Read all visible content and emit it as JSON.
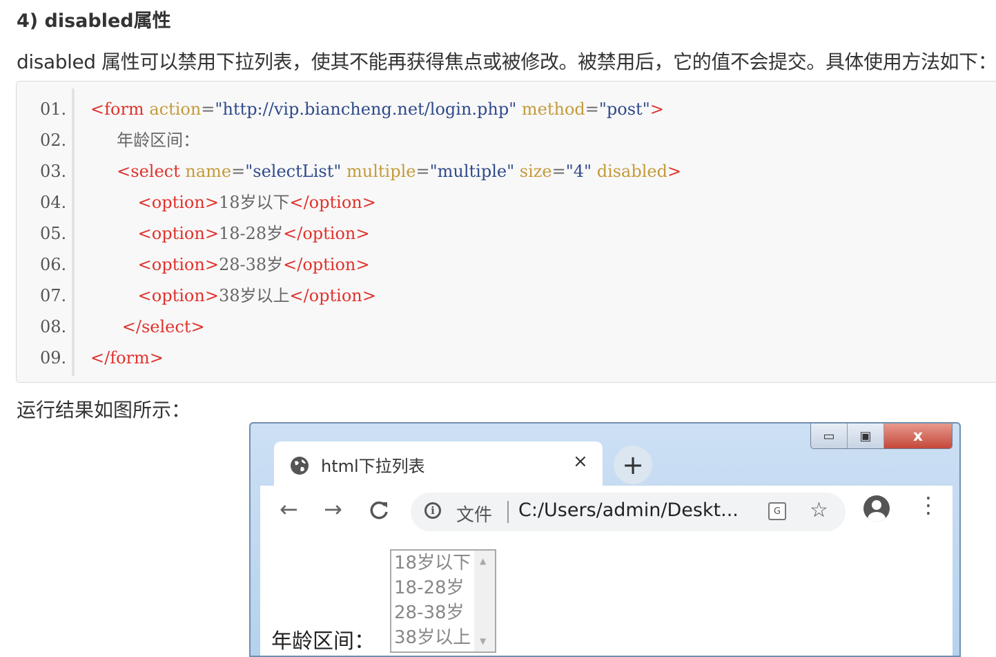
{
  "heading": "4) disabled属性",
  "paragraph": "disabled 属性可以禁用下拉列表，使其不能再获得焦点或被修改。被禁用后，它的值不会提交。具体使用方法如下：",
  "code": {
    "line_numbers": [
      "01.",
      "02.",
      "03.",
      "04.",
      "05.",
      "06.",
      "07.",
      "08.",
      "09."
    ],
    "lines": [
      [
        {
          "t": "tag",
          "v": "<form"
        },
        {
          "t": "txt",
          "v": " "
        },
        {
          "t": "attr",
          "v": "action"
        },
        {
          "t": "txt",
          "v": "="
        },
        {
          "t": "str",
          "v": "\"http://vip.biancheng.net/login.php\""
        },
        {
          "t": "txt",
          "v": " "
        },
        {
          "t": "attr",
          "v": "method"
        },
        {
          "t": "txt",
          "v": "="
        },
        {
          "t": "str",
          "v": "\"post\""
        },
        {
          "t": "tag",
          "v": ">"
        }
      ],
      [
        {
          "t": "txt",
          "v": "     年龄区间："
        }
      ],
      [
        {
          "t": "txt",
          "v": "     "
        },
        {
          "t": "tag",
          "v": "<select"
        },
        {
          "t": "txt",
          "v": " "
        },
        {
          "t": "attr",
          "v": "name"
        },
        {
          "t": "txt",
          "v": "="
        },
        {
          "t": "str",
          "v": "\"selectList\""
        },
        {
          "t": "txt",
          "v": " "
        },
        {
          "t": "attr",
          "v": "multiple"
        },
        {
          "t": "txt",
          "v": "="
        },
        {
          "t": "str",
          "v": "\"multiple\""
        },
        {
          "t": "txt",
          "v": " "
        },
        {
          "t": "attr",
          "v": "size"
        },
        {
          "t": "txt",
          "v": "="
        },
        {
          "t": "str",
          "v": "\"4\""
        },
        {
          "t": "txt",
          "v": " "
        },
        {
          "t": "attr",
          "v": "disabled"
        },
        {
          "t": "tag",
          "v": ">"
        }
      ],
      [
        {
          "t": "txt",
          "v": "         "
        },
        {
          "t": "tag",
          "v": "<option>"
        },
        {
          "t": "txt",
          "v": "18岁以下"
        },
        {
          "t": "tag",
          "v": "</option>"
        }
      ],
      [
        {
          "t": "txt",
          "v": "         "
        },
        {
          "t": "tag",
          "v": "<option>"
        },
        {
          "t": "txt",
          "v": "18-28岁"
        },
        {
          "t": "tag",
          "v": "</option>"
        }
      ],
      [
        {
          "t": "txt",
          "v": "         "
        },
        {
          "t": "tag",
          "v": "<option>"
        },
        {
          "t": "txt",
          "v": "28-38岁"
        },
        {
          "t": "tag",
          "v": "</option>"
        }
      ],
      [
        {
          "t": "txt",
          "v": "         "
        },
        {
          "t": "tag",
          "v": "<option>"
        },
        {
          "t": "txt",
          "v": "38岁以上"
        },
        {
          "t": "tag",
          "v": "</option>"
        }
      ],
      [
        {
          "t": "txt",
          "v": "      "
        },
        {
          "t": "tag",
          "v": "</select>"
        }
      ],
      [
        {
          "t": "tag",
          "v": "</form>"
        }
      ]
    ]
  },
  "result_label": "运行结果如图所示：",
  "browser": {
    "tab_title": "html下拉列表",
    "tab_close": "×",
    "new_tab": "+",
    "window_controls": {
      "minimize": "▭",
      "maximize": "▣",
      "close": "x"
    },
    "nav": {
      "back": "←",
      "forward": "→",
      "reload": "C"
    },
    "omnibox": {
      "info": "i",
      "file_label": "文件",
      "url": "C:/Users/admin/Deskt..."
    },
    "translate": "G",
    "star": "☆",
    "menu": "⋮",
    "age_label": "年龄区间：",
    "options": [
      "18岁以下",
      "18-28岁",
      "28-38岁",
      "38岁以上"
    ]
  }
}
